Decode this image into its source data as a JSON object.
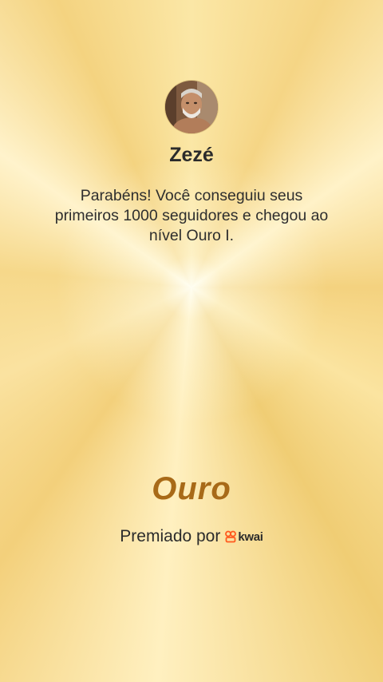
{
  "profile": {
    "username": "Zezé",
    "avatar_icon": "user-avatar-photo"
  },
  "message": "Parabéns! Você conseguiu seus primeiros 1000 seguidores e chegou ao nível Ouro I.",
  "level": {
    "name": "Ouro",
    "color": "#a86a18"
  },
  "awarded_by": {
    "label": "Premiado por",
    "brand_name": "kwai",
    "brand_icon": "kwai-logo-icon",
    "brand_color": "#ff5a1f"
  }
}
